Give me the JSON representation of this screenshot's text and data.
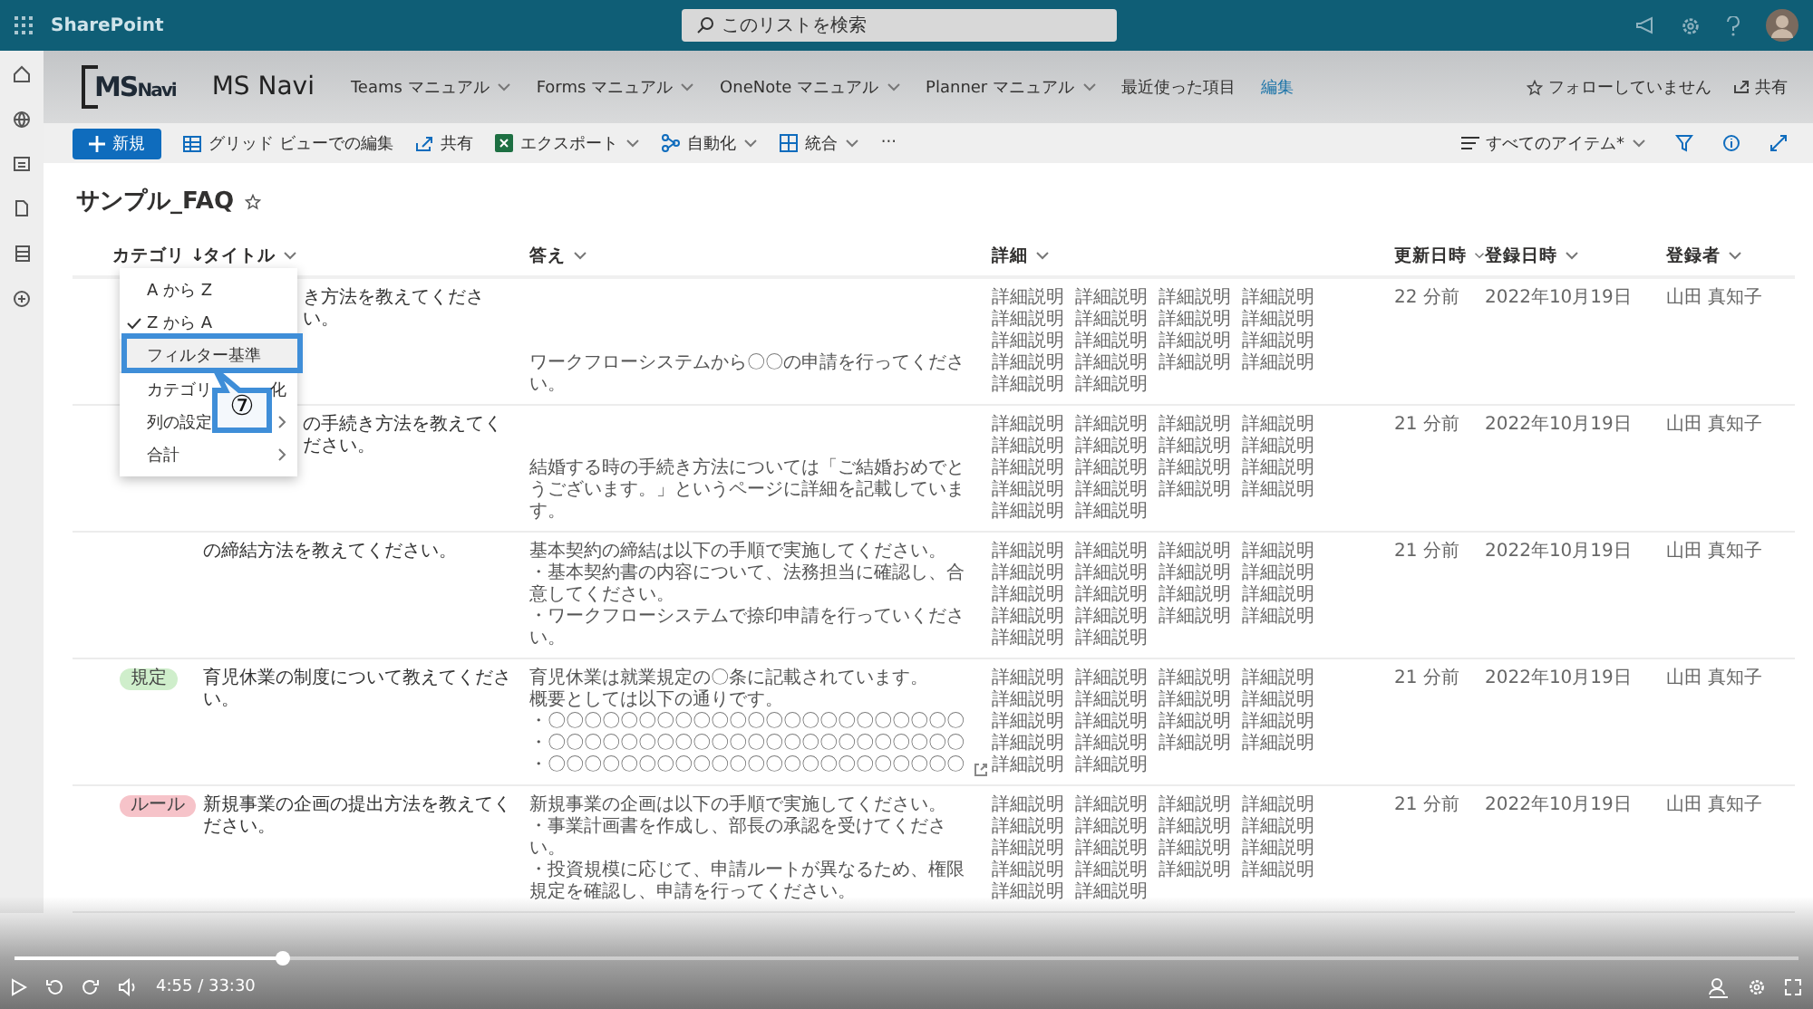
{
  "top_bar": {
    "app_name": "SharePoint",
    "search": {
      "placeholder": "このリストを検索"
    }
  },
  "site_header": {
    "logo": {
      "ms": "MS",
      "navi": "Navi"
    },
    "site_title": "MS Navi",
    "nav": [
      {
        "label": "Teams マニュアル",
        "kind": "menu"
      },
      {
        "label": "Forms マニュアル",
        "kind": "menu"
      },
      {
        "label": "OneNote マニュアル",
        "kind": "menu"
      },
      {
        "label": "Planner マニュアル",
        "kind": "menu"
      },
      {
        "label": "最近使った項目",
        "kind": "plain"
      },
      {
        "label": "編集",
        "kind": "link"
      }
    ],
    "follow": "フォローしていません",
    "share": "共有"
  },
  "command_bar": {
    "items": [
      {
        "label": "新規",
        "kind": "new"
      },
      {
        "label": "グリッド ビューでの編集",
        "kind": "grid"
      },
      {
        "label": "共有",
        "kind": "share"
      },
      {
        "label": "エクスポート",
        "kind": "export"
      },
      {
        "label": "自動化",
        "kind": "automate"
      },
      {
        "label": "統合",
        "kind": "integrate"
      },
      {
        "label": "···",
        "kind": "more"
      }
    ],
    "view": "すべてのアイテム*"
  },
  "list": {
    "title": "サンプル_FAQ",
    "columns": [
      {
        "label": "カテゴリ",
        "sort_mark": "↓"
      },
      {
        "label": "タイトル"
      },
      {
        "label": "答え"
      },
      {
        "label": "詳細"
      },
      {
        "label": "更新日時"
      },
      {
        "label": "登録日時"
      },
      {
        "label": "登録者"
      }
    ],
    "rows": [
      {
        "title": "き方法を教えてください。",
        "answer": [
          "ワークフローシステムから〇〇の申請を行ってください。"
        ],
        "details": [
          "詳細説明",
          "詳細説明",
          "詳細説明",
          "詳細説明",
          "詳細説明",
          "詳細説明",
          "詳細説明",
          "詳細説明",
          "詳細説明",
          "詳細説明",
          "詳細説明",
          "詳細説明",
          "詳細説明",
          "詳細説明",
          "詳細説明",
          "詳細説明",
          "詳細説明",
          "詳細説明"
        ],
        "updated": "22 分前",
        "created": "2022年10月19日",
        "author": "山田 真知子"
      },
      {
        "title": "の手続き方法を教えてください。",
        "answer": [
          "結婚する時の手続き方法については「ご結婚おめでとうございます。」というページに詳細を記載しています。"
        ],
        "details": [
          "詳細説明",
          "詳細説明",
          "詳細説明",
          "詳細説明",
          "詳細説明",
          "詳細説明",
          "詳細説明",
          "詳細説明",
          "詳細説明",
          "詳細説明",
          "詳細説明",
          "詳細説明",
          "詳細説明",
          "詳細説明",
          "詳細説明",
          "詳細説明",
          "詳細説明",
          "詳細説明"
        ],
        "updated": "21 分前",
        "created": "2022年10月19日",
        "author": "山田 真知子"
      },
      {
        "title": "の締結方法を教えてください。",
        "answer": [
          "基本契約の締結は以下の手順で実施してください。",
          "・基本契約書の内容について、法務担当に確認し、合意してください。",
          "・ワークフローシステムで捺印申請を行っていください。"
        ],
        "details": [
          "詳細説明",
          "詳細説明",
          "詳細説明",
          "詳細説明",
          "詳細説明",
          "詳細説明",
          "詳細説明",
          "詳細説明",
          "詳細説明",
          "詳細説明",
          "詳細説明",
          "詳細説明",
          "詳細説明",
          "詳細説明",
          "詳細説明",
          "詳細説明",
          "詳細説明",
          "詳細説明"
        ],
        "updated": "21 分前",
        "created": "2022年10月19日",
        "author": "山田 真知子"
      },
      {
        "category": {
          "label": "規定",
          "color": "#cfeecb"
        },
        "title": "育児休業の制度について教えてください。",
        "answer": [
          "育児休業は就業規定の〇条に記載されています。",
          "概要としては以下の通りです。",
          "・〇〇〇〇〇〇〇〇〇〇〇〇〇〇〇〇〇〇〇〇〇〇〇",
          "・〇〇〇〇〇〇〇〇〇〇〇〇〇〇〇〇〇〇〇〇〇〇〇",
          "・〇〇〇〇〇〇〇〇〇〇〇〇〇〇〇〇〇〇〇〇〇〇〇"
        ],
        "expand": true,
        "details": [
          "詳細説明",
          "詳細説明",
          "詳細説明",
          "詳細説明",
          "詳細説明",
          "詳細説明",
          "詳細説明",
          "詳細説明",
          "詳細説明",
          "詳細説明",
          "詳細説明",
          "詳細説明",
          "詳細説明",
          "詳細説明",
          "詳細説明",
          "詳細説明",
          "詳細説明",
          "詳細説明"
        ],
        "updated": "21 分前",
        "created": "2022年10月19日",
        "author": "山田 真知子"
      },
      {
        "category": {
          "label": "ルール",
          "color": "#f6c3c9"
        },
        "title": "新規事業の企画の提出方法を教えてください。",
        "answer": [
          "新規事業の企画は以下の手順で実施してください。",
          "・事業計画書を作成し、部長の承認を受けてください。",
          "・投資規模に応じて、申請ルートが異なるため、権限規定を確認し、申請を行ってください。"
        ],
        "details": [
          "詳細説明",
          "詳細説明",
          "詳細説明",
          "詳細説明",
          "詳細説明",
          "詳細説明",
          "詳細説明",
          "詳細説明",
          "詳細説明",
          "詳細説明",
          "詳細説明",
          "詳細説明",
          "詳細説明",
          "詳細説明",
          "詳細説明",
          "詳細説明",
          "詳細説明",
          "詳細説明"
        ],
        "updated": "21 分前",
        "created": "2022年10月19日",
        "author": "山田 真知子"
      }
    ]
  },
  "column_menu": {
    "items": [
      {
        "label": "A から Z",
        "checked": false,
        "selected": false,
        "submenu": false
      },
      {
        "label": "Z から A",
        "checked": true,
        "selected": false,
        "submenu": false
      },
      {
        "label": "フィルター基準",
        "checked": false,
        "selected": true,
        "submenu": false
      },
      {
        "label": "カテゴリ",
        "label_end": "化",
        "checked": false,
        "selected": false,
        "submenu": false
      },
      {
        "label": "列の設定",
        "checked": false,
        "selected": false,
        "submenu": true
      },
      {
        "label": "合計",
        "checked": false,
        "selected": false,
        "submenu": true
      }
    ],
    "callout": {
      "number": "⑦"
    }
  },
  "player": {
    "level": 0.15,
    "time": "4:55 / 33:30"
  }
}
